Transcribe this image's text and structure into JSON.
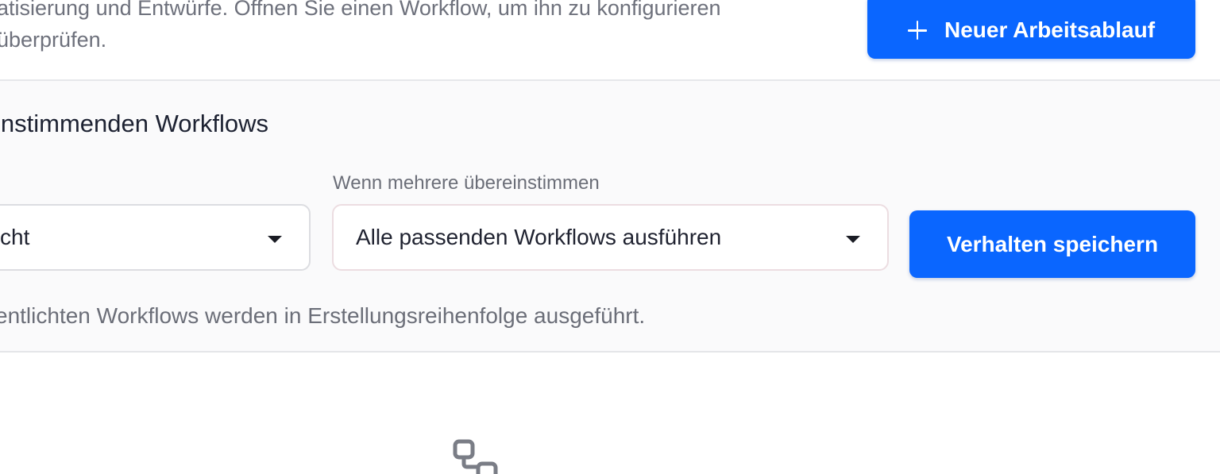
{
  "header": {
    "description_line1": "atisierung und Entwürfe. Öffnen Sie einen Workflow, um ihn zu konfigurieren",
    "description_line2": "überprüfen.",
    "new_button_label": "Neuer Arbeitsablauf",
    "new_button_icon": "plus-icon"
  },
  "behavior": {
    "title": "instimmenden Workflows",
    "left_select_value": "cht",
    "multi_match_label": "Wenn mehrere übereinstimmen",
    "multi_match_value": "Alle passenden Workflows ausführen",
    "save_button_label": "Verhalten speichern",
    "hint": "entlichten Workflows werden in Erstellungsreihenfolge ausgeführt."
  },
  "empty_state": {
    "icon": "workflow-icon"
  },
  "colors": {
    "primary": "#0a66ff",
    "panel_bg": "#fafafb",
    "muted_text": "#6e717c"
  }
}
